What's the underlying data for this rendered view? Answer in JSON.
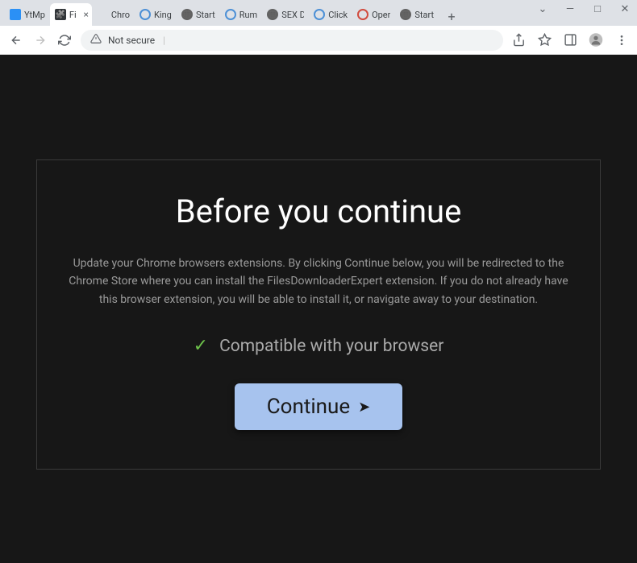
{
  "tabs": [
    {
      "label": "YtMp",
      "favicon": "favicon-blue"
    },
    {
      "label": "Fi",
      "favicon": "favicon-puzzle",
      "active": true,
      "close": true
    },
    {
      "label": "Chro",
      "favicon": ""
    },
    {
      "label": "King",
      "favicon": "favicon-circle"
    },
    {
      "label": "Start",
      "favicon": "favicon-globe"
    },
    {
      "label": "Rum",
      "favicon": "favicon-circle"
    },
    {
      "label": "SEX D",
      "favicon": "favicon-globe"
    },
    {
      "label": "Click",
      "favicon": "favicon-circle"
    },
    {
      "label": "Oper",
      "favicon": "favicon-red"
    },
    {
      "label": "Start",
      "favicon": "favicon-globe"
    }
  ],
  "omnibox": {
    "warning_icon": "⚠",
    "warning_text": "Not secure"
  },
  "dialog": {
    "title": "Before you continue",
    "body": "Update your Chrome browsers extensions. By clicking Continue below, you will be redirected to the Chrome Store where you can install the FilesDownloaderExpert extension. If you do not already have this browser extension, you will be able to install it, or navigate away to your destination.",
    "compat": "Compatible with your browser",
    "button": "Continue"
  }
}
